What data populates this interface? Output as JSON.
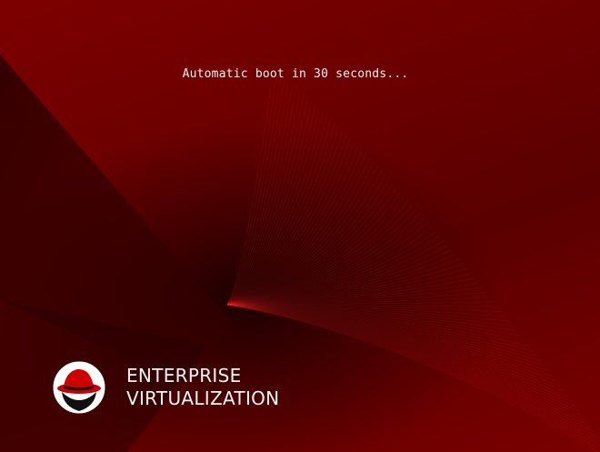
{
  "boot": {
    "message": "Automatic boot in 30 seconds..."
  },
  "brand": {
    "logo_icon": "red-hat-shadowman-icon",
    "line1": "ENTERPRISE",
    "line2": "VIRTUALIZATION"
  },
  "colors": {
    "background_red": "#7a0000",
    "dark_red": "#2a0000",
    "text": "#f2f2f2",
    "logo_red": "#cc0000"
  }
}
